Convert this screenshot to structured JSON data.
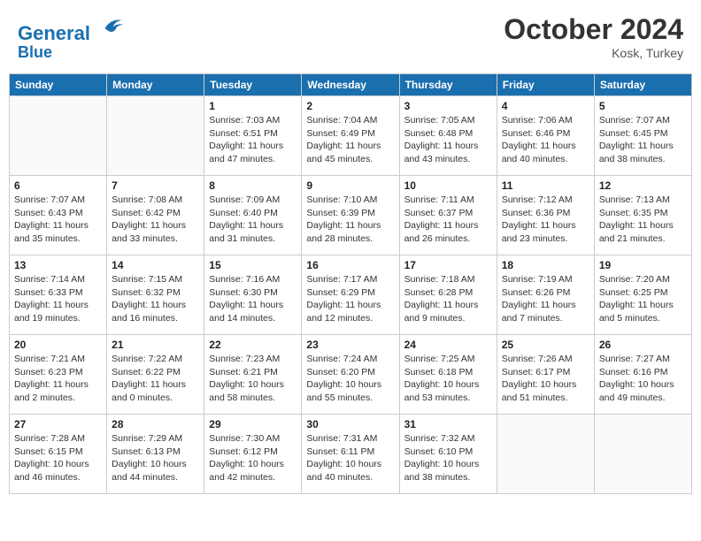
{
  "header": {
    "logo_line1": "General",
    "logo_line2": "Blue",
    "month": "October 2024",
    "location": "Kosk, Turkey"
  },
  "weekdays": [
    "Sunday",
    "Monday",
    "Tuesday",
    "Wednesday",
    "Thursday",
    "Friday",
    "Saturday"
  ],
  "weeks": [
    [
      {
        "day": "",
        "detail": ""
      },
      {
        "day": "",
        "detail": ""
      },
      {
        "day": "1",
        "detail": "Sunrise: 7:03 AM\nSunset: 6:51 PM\nDaylight: 11 hours\nand 47 minutes."
      },
      {
        "day": "2",
        "detail": "Sunrise: 7:04 AM\nSunset: 6:49 PM\nDaylight: 11 hours\nand 45 minutes."
      },
      {
        "day": "3",
        "detail": "Sunrise: 7:05 AM\nSunset: 6:48 PM\nDaylight: 11 hours\nand 43 minutes."
      },
      {
        "day": "4",
        "detail": "Sunrise: 7:06 AM\nSunset: 6:46 PM\nDaylight: 11 hours\nand 40 minutes."
      },
      {
        "day": "5",
        "detail": "Sunrise: 7:07 AM\nSunset: 6:45 PM\nDaylight: 11 hours\nand 38 minutes."
      }
    ],
    [
      {
        "day": "6",
        "detail": "Sunrise: 7:07 AM\nSunset: 6:43 PM\nDaylight: 11 hours\nand 35 minutes."
      },
      {
        "day": "7",
        "detail": "Sunrise: 7:08 AM\nSunset: 6:42 PM\nDaylight: 11 hours\nand 33 minutes."
      },
      {
        "day": "8",
        "detail": "Sunrise: 7:09 AM\nSunset: 6:40 PM\nDaylight: 11 hours\nand 31 minutes."
      },
      {
        "day": "9",
        "detail": "Sunrise: 7:10 AM\nSunset: 6:39 PM\nDaylight: 11 hours\nand 28 minutes."
      },
      {
        "day": "10",
        "detail": "Sunrise: 7:11 AM\nSunset: 6:37 PM\nDaylight: 11 hours\nand 26 minutes."
      },
      {
        "day": "11",
        "detail": "Sunrise: 7:12 AM\nSunset: 6:36 PM\nDaylight: 11 hours\nand 23 minutes."
      },
      {
        "day": "12",
        "detail": "Sunrise: 7:13 AM\nSunset: 6:35 PM\nDaylight: 11 hours\nand 21 minutes."
      }
    ],
    [
      {
        "day": "13",
        "detail": "Sunrise: 7:14 AM\nSunset: 6:33 PM\nDaylight: 11 hours\nand 19 minutes."
      },
      {
        "day": "14",
        "detail": "Sunrise: 7:15 AM\nSunset: 6:32 PM\nDaylight: 11 hours\nand 16 minutes."
      },
      {
        "day": "15",
        "detail": "Sunrise: 7:16 AM\nSunset: 6:30 PM\nDaylight: 11 hours\nand 14 minutes."
      },
      {
        "day": "16",
        "detail": "Sunrise: 7:17 AM\nSunset: 6:29 PM\nDaylight: 11 hours\nand 12 minutes."
      },
      {
        "day": "17",
        "detail": "Sunrise: 7:18 AM\nSunset: 6:28 PM\nDaylight: 11 hours\nand 9 minutes."
      },
      {
        "day": "18",
        "detail": "Sunrise: 7:19 AM\nSunset: 6:26 PM\nDaylight: 11 hours\nand 7 minutes."
      },
      {
        "day": "19",
        "detail": "Sunrise: 7:20 AM\nSunset: 6:25 PM\nDaylight: 11 hours\nand 5 minutes."
      }
    ],
    [
      {
        "day": "20",
        "detail": "Sunrise: 7:21 AM\nSunset: 6:23 PM\nDaylight: 11 hours\nand 2 minutes."
      },
      {
        "day": "21",
        "detail": "Sunrise: 7:22 AM\nSunset: 6:22 PM\nDaylight: 11 hours\nand 0 minutes."
      },
      {
        "day": "22",
        "detail": "Sunrise: 7:23 AM\nSunset: 6:21 PM\nDaylight: 10 hours\nand 58 minutes."
      },
      {
        "day": "23",
        "detail": "Sunrise: 7:24 AM\nSunset: 6:20 PM\nDaylight: 10 hours\nand 55 minutes."
      },
      {
        "day": "24",
        "detail": "Sunrise: 7:25 AM\nSunset: 6:18 PM\nDaylight: 10 hours\nand 53 minutes."
      },
      {
        "day": "25",
        "detail": "Sunrise: 7:26 AM\nSunset: 6:17 PM\nDaylight: 10 hours\nand 51 minutes."
      },
      {
        "day": "26",
        "detail": "Sunrise: 7:27 AM\nSunset: 6:16 PM\nDaylight: 10 hours\nand 49 minutes."
      }
    ],
    [
      {
        "day": "27",
        "detail": "Sunrise: 7:28 AM\nSunset: 6:15 PM\nDaylight: 10 hours\nand 46 minutes."
      },
      {
        "day": "28",
        "detail": "Sunrise: 7:29 AM\nSunset: 6:13 PM\nDaylight: 10 hours\nand 44 minutes."
      },
      {
        "day": "29",
        "detail": "Sunrise: 7:30 AM\nSunset: 6:12 PM\nDaylight: 10 hours\nand 42 minutes."
      },
      {
        "day": "30",
        "detail": "Sunrise: 7:31 AM\nSunset: 6:11 PM\nDaylight: 10 hours\nand 40 minutes."
      },
      {
        "day": "31",
        "detail": "Sunrise: 7:32 AM\nSunset: 6:10 PM\nDaylight: 10 hours\nand 38 minutes."
      },
      {
        "day": "",
        "detail": ""
      },
      {
        "day": "",
        "detail": ""
      }
    ]
  ]
}
